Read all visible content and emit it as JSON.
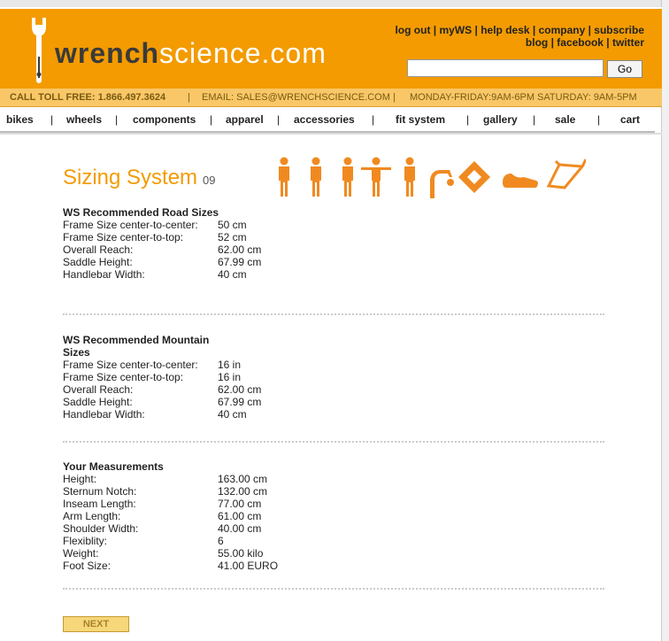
{
  "brand": {
    "logo_bold": "wrench",
    "logo_rest": "science.com"
  },
  "toplinks": {
    "line1": [
      "log out",
      "myWS",
      "help desk",
      "company",
      "subscribe"
    ],
    "line2": [
      "blog",
      "facebook",
      "twitter"
    ]
  },
  "search": {
    "value": "",
    "go_label": "Go"
  },
  "contact": {
    "phone": "CALL TOLL FREE: 1.866.497.3624",
    "email": "EMAIL: SALES@WRENCHSCIENCE.COM",
    "hours": "MONDAY-FRIDAY:9AM-6PM SATURDAY: 9AM-5PM"
  },
  "nav": [
    "bikes",
    "wheels",
    "components",
    "apparel",
    "accessories",
    "fit system",
    "gallery",
    "sale",
    "cart"
  ],
  "page": {
    "title": "Sizing System",
    "version": "09"
  },
  "road": {
    "heading": "WS Recommended Road Sizes",
    "rows": [
      {
        "label": "Frame Size center-to-center:",
        "value": "50 cm"
      },
      {
        "label": "Frame Size center-to-top:",
        "value": "52 cm"
      },
      {
        "label": "Overall Reach:",
        "value": "62.00 cm"
      },
      {
        "label": "Saddle Height:",
        "value": "67.99 cm"
      },
      {
        "label": "Handlebar Width:",
        "value": "40 cm"
      }
    ]
  },
  "mountain": {
    "heading": "WS Recommended Mountain Sizes",
    "rows": [
      {
        "label": "Frame Size center-to-center:",
        "value": "16 in"
      },
      {
        "label": "Frame Size center-to-top:",
        "value": "16 in"
      },
      {
        "label": "Overall Reach:",
        "value": "62.00 cm"
      },
      {
        "label": "Saddle Height:",
        "value": "67.99 cm"
      },
      {
        "label": "Handlebar Width:",
        "value": "40 cm"
      }
    ]
  },
  "measurements": {
    "heading": "Your Measurements",
    "rows": [
      {
        "label": "Height:",
        "value": "163.00 cm"
      },
      {
        "label": "Sternum Notch:",
        "value": "132.00 cm"
      },
      {
        "label": "Inseam Length:",
        "value": "77.00 cm"
      },
      {
        "label": "Arm Length:",
        "value": "61.00 cm"
      },
      {
        "label": "Shoulder Width:",
        "value": "40.00 cm"
      },
      {
        "label": "Flexiblity:",
        "value": "6"
      },
      {
        "label": "Weight:",
        "value": "55.00 kilo"
      },
      {
        "label": "Foot Size:",
        "value": "41.00 EURO"
      }
    ]
  },
  "next_label": "NEXT",
  "colors": {
    "brand_orange": "#f39b00",
    "contact_bar": "#f9c767"
  }
}
